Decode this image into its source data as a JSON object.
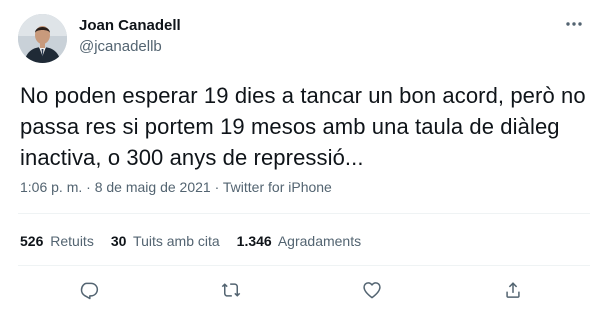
{
  "author": {
    "name": "Joan Canadell",
    "handle": "@jcanadellb"
  },
  "tweet": {
    "text": "No poden esperar 19 dies a tancar un bon acord, però no passa res si portem 19 mesos amb una taula de diàleg inactiva, o 300 anys de repressió...",
    "time": "1:06 p. m.",
    "separator": "·",
    "date": "8 de maig de 2021",
    "source": "Twitter for iPhone"
  },
  "stats": {
    "retweets_count": "526",
    "retweets_label": "Retuits",
    "quotes_count": "30",
    "quotes_label": "Tuits amb cita",
    "likes_count": "1.346",
    "likes_label": "Agradaments"
  },
  "icons": {
    "more": "more-icon",
    "reply": "reply-icon",
    "retweet": "retweet-icon",
    "like": "heart-icon",
    "share": "share-icon"
  },
  "colors": {
    "text": "#0f1419",
    "secondary": "#536471",
    "divider": "#eff3f4"
  }
}
